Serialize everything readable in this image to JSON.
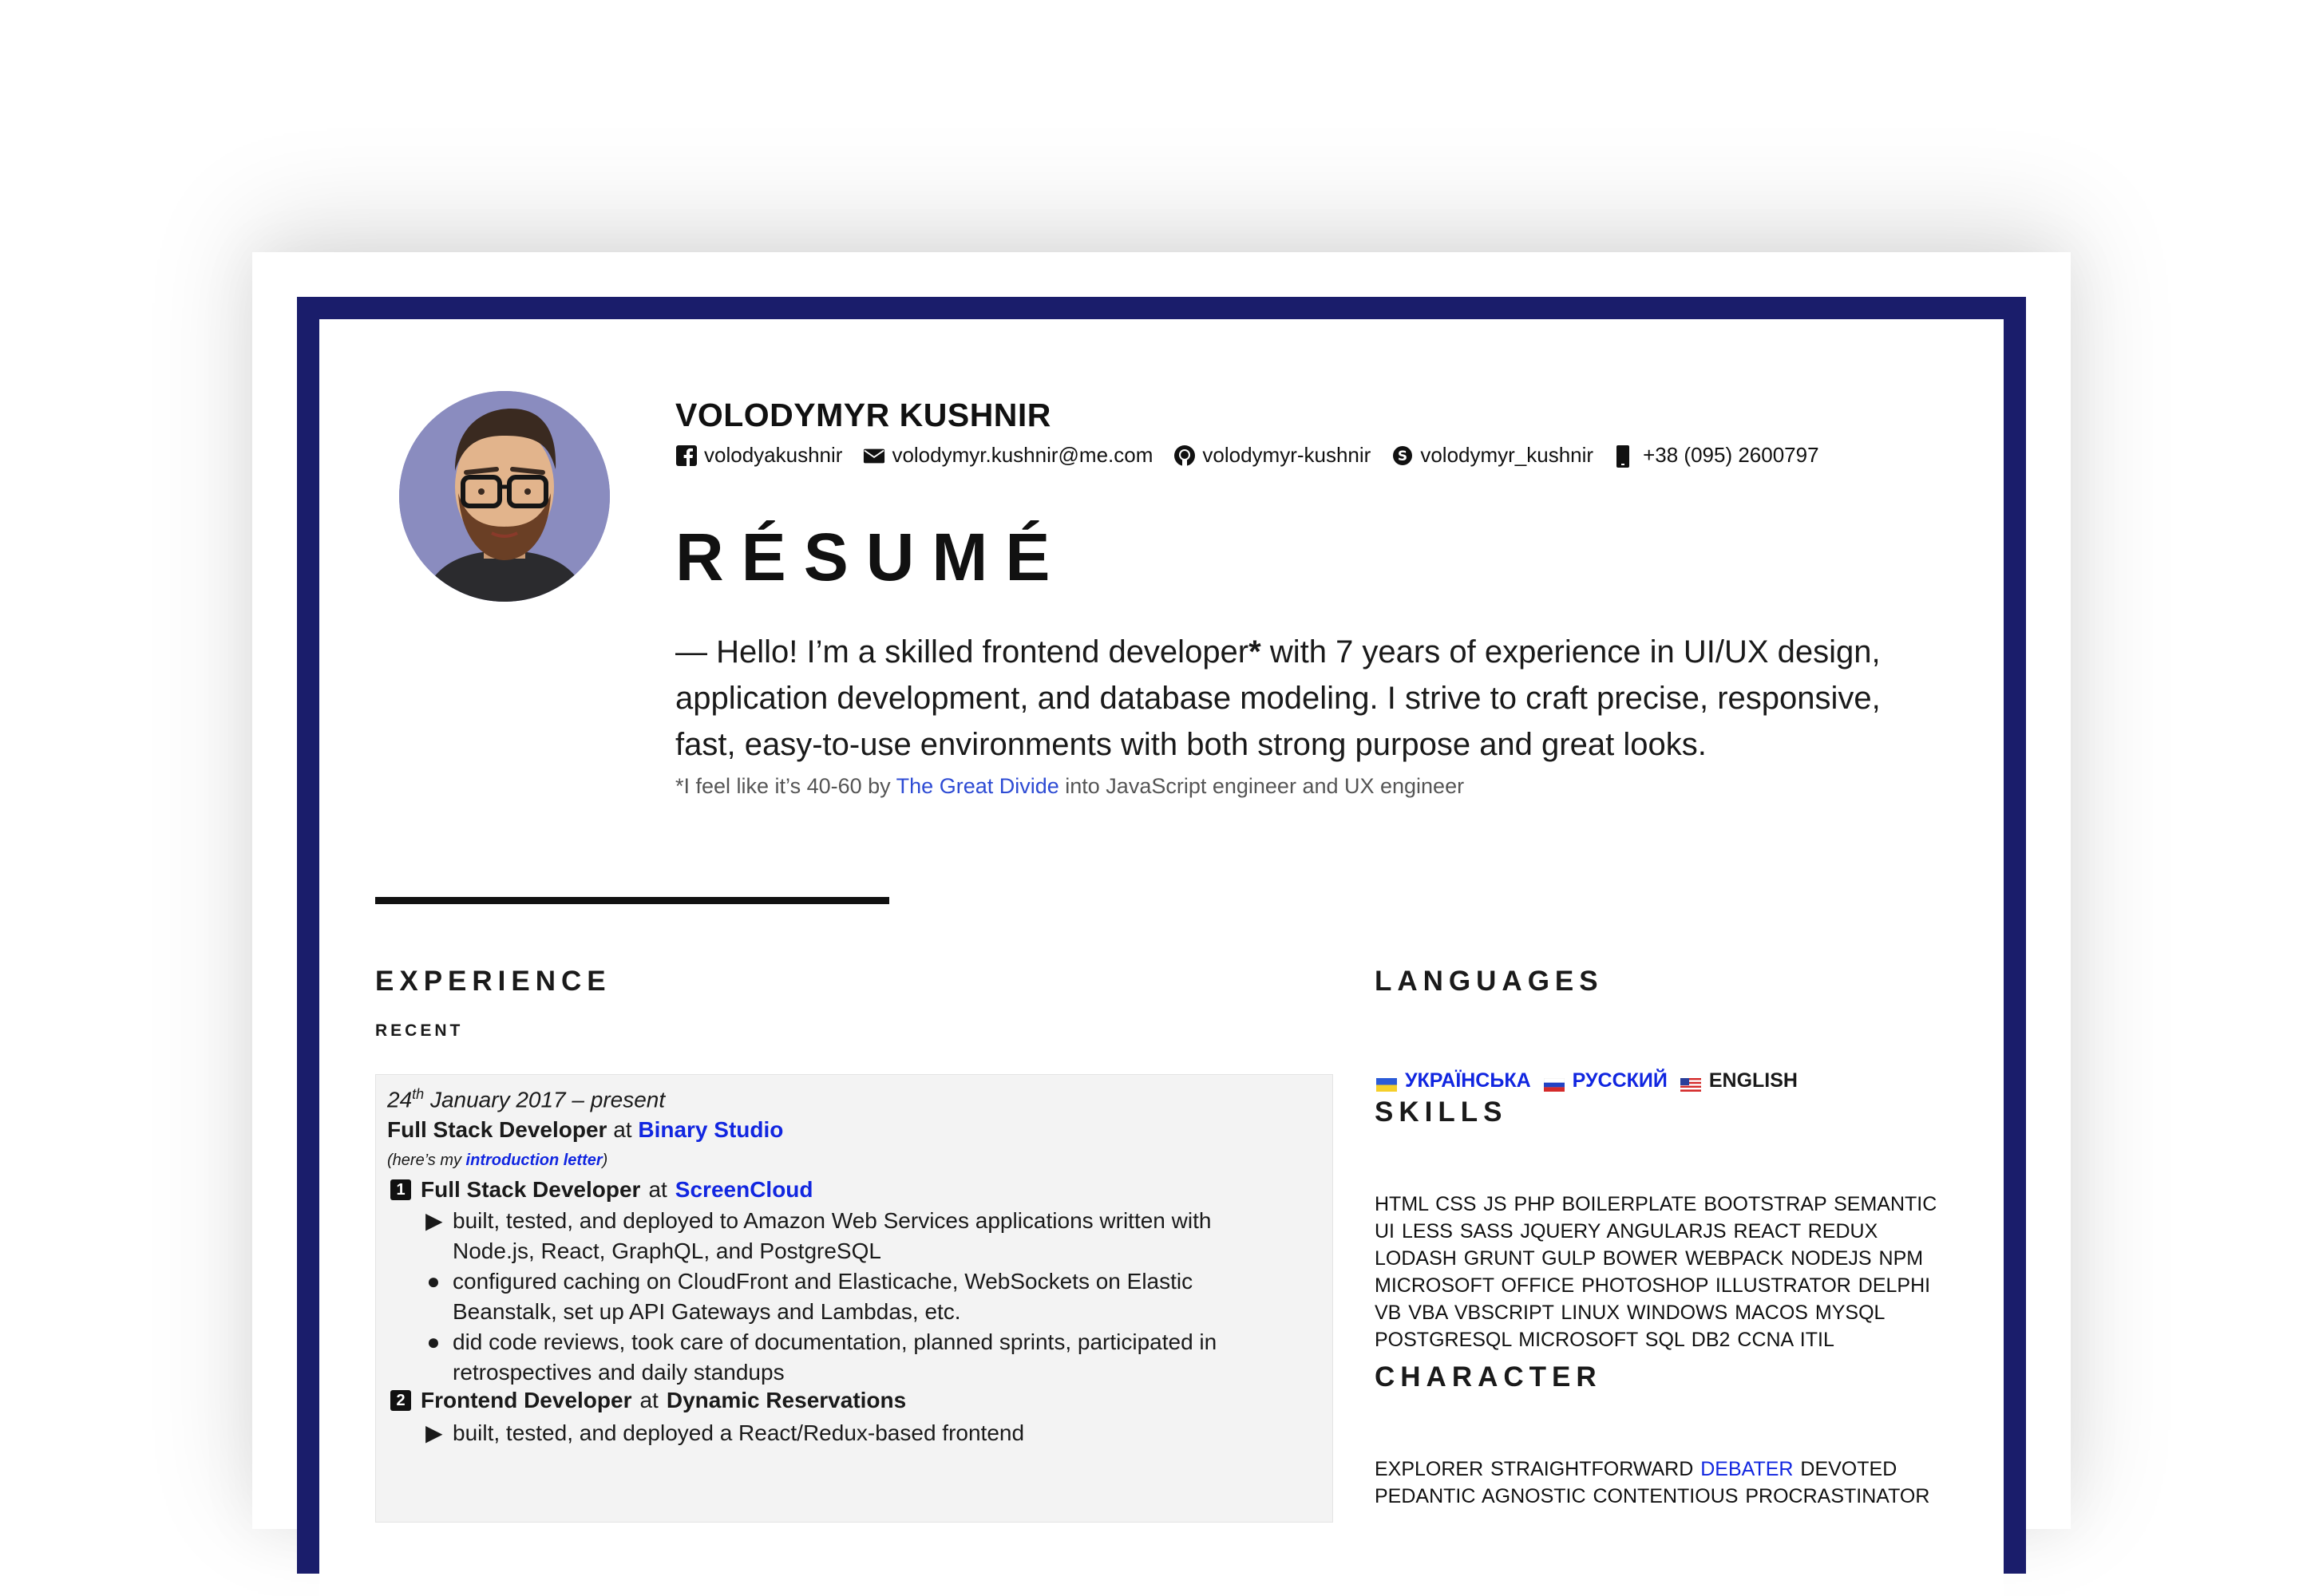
{
  "header": {
    "name": "VOLODYMYR KUSHNIR",
    "contacts": [
      {
        "icon": "facebook-icon",
        "text": "volodyakushnir"
      },
      {
        "icon": "mail-icon",
        "text": "volodymyr.kushnir@me.com"
      },
      {
        "icon": "github-icon",
        "text": "volodymyr-kushnir"
      },
      {
        "icon": "skype-icon",
        "text": "volodymyr_kushnir"
      },
      {
        "icon": "phone-icon",
        "text": "+38 (095) 2600797"
      }
    ],
    "title": "RÉSUMÉ",
    "intro": {
      "part1": "— Hello! I’m a skilled frontend developer",
      "star": "*",
      "part2": " with 7 years of experience in UI/UX design, application development, and database modeling. I strive to craft precise, responsive, fast, easy-to-use environments with both strong purpose and great looks."
    },
    "footnote": {
      "prefix": "*I feel like it’s 40-60 by ",
      "link": "The Great Divide",
      "suffix": " into JavaScript engineer and UX engineer"
    }
  },
  "experience": {
    "heading": "EXPERIENCE",
    "subheading": "RECENT",
    "date_day": "24",
    "date_sup": "th",
    "date_rest": " January 2017 – present",
    "role": "Full Stack Developer",
    "at": "at",
    "company": "Binary Studio",
    "note_prefix": "(here’s my ",
    "note_link": "introduction letter",
    "note_suffix": ")",
    "jobs": [
      {
        "num": "1",
        "title": "Full Stack Developer",
        "at": "at",
        "company": "ScreenCloud",
        "bullets": [
          {
            "marker": "▶",
            "text": "built, tested, and deployed to Amazon Web Services applications written with Node.js, React, GraphQL, and PostgreSQL"
          },
          {
            "marker": "●",
            "text": "configured caching on CloudFront and Elasticache, WebSockets on Elastic Beanstalk, set up API Gateways and Lambdas, etc."
          },
          {
            "marker": "●",
            "text": "did code reviews, took care of documentation, planned sprints, participated in retrospectives and daily standups"
          }
        ]
      },
      {
        "num": "2",
        "title": "Frontend Developer",
        "at": "at",
        "company": "Dynamic Reservations",
        "bullets": [
          {
            "marker": "▶",
            "text": "built, tested, and deployed a React/Redux-based frontend"
          }
        ]
      }
    ]
  },
  "languages": {
    "heading": "LANGUAGES",
    "items": [
      {
        "flag": "ukraine-flag-icon",
        "label": "УКРАЇНСЬКА",
        "link": true
      },
      {
        "flag": "russia-flag-icon",
        "label": "РУССКИЙ",
        "link": true
      },
      {
        "flag": "usa-flag-icon",
        "label": "ENGLISH",
        "link": false
      }
    ]
  },
  "skills": {
    "heading": "SKILLS",
    "text": "HTML CSS JS PHP BOILERPLATE BOOTSTRAP SEMANTIC UI LESS SASS JQUERY ANGULARJS REACT REDUX LODASH GRUNT GULP BOWER WEBPACK NODEJS NPM MICROSOFT OFFICE PHOTOSHOP ILLUSTRATOR DELPHI VB VBA VBSCRIPT LINUX WINDOWS MACOS MYSQL POSTGRESQL MICROSOFT SQL DB2 CCNA ITIL"
  },
  "character": {
    "heading": "CHARACTER",
    "before": "EXPLORER STRAIGHTFORWARD ",
    "highlight": "DEBATER",
    "after": " DEVOTED PEDANTIC AGNOSTIC CONTENTIOUS PROCRASTINATOR"
  },
  "colors": {
    "frame": "#1a1d6b",
    "link": "#1126e0",
    "soft_link": "#2d4bd4",
    "avatar_bg": "#8a8cbf"
  }
}
